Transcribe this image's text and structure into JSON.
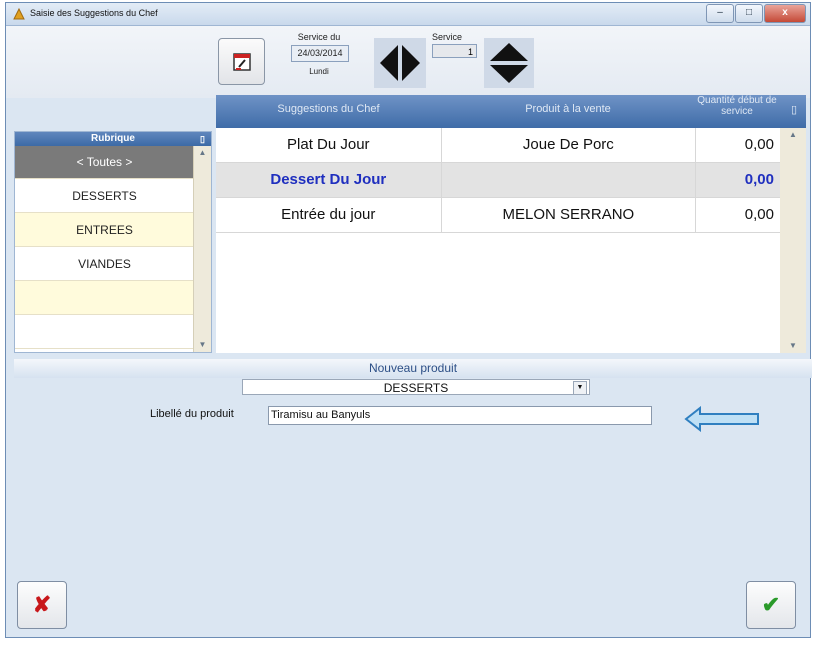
{
  "window": {
    "title": "Saisie des Suggestions du Chef",
    "controls": [
      "–",
      "□",
      "x"
    ]
  },
  "toolbar": {
    "service_du_label": "Service du",
    "date": "24/03/2014",
    "day": "Lundi",
    "service_label": "Service",
    "service_value": "1"
  },
  "sidebar": {
    "header": "Rubrique",
    "items": [
      {
        "label": "< Toutes >"
      },
      {
        "label": "DESSERTS"
      },
      {
        "label": "ENTREES"
      },
      {
        "label": "VIANDES"
      },
      {
        "label": ""
      },
      {
        "label": ""
      }
    ]
  },
  "grid": {
    "columns": [
      "Suggestions du Chef",
      "Produit à la vente",
      "Quantité début de service"
    ],
    "rows": [
      {
        "suggestion": "Plat Du Jour",
        "produit": "Joue De Porc",
        "quantite": "0,00"
      },
      {
        "suggestion": "Dessert Du Jour",
        "produit": "",
        "quantite": "0,00"
      },
      {
        "suggestion": "Entrée du jour",
        "produit": "MELON SERRANO",
        "quantite": "0,00"
      }
    ]
  },
  "new_product": {
    "header": "Nouveau produit",
    "category_selected": "DESSERTS",
    "libelle_label": "Libellé du produit",
    "libelle_value": "Tiramisu au Banyuls"
  },
  "colors": {
    "accent": "#3f6ca8",
    "highlight_text": "#1f2fbf",
    "arrow": "#3a8fd0"
  }
}
